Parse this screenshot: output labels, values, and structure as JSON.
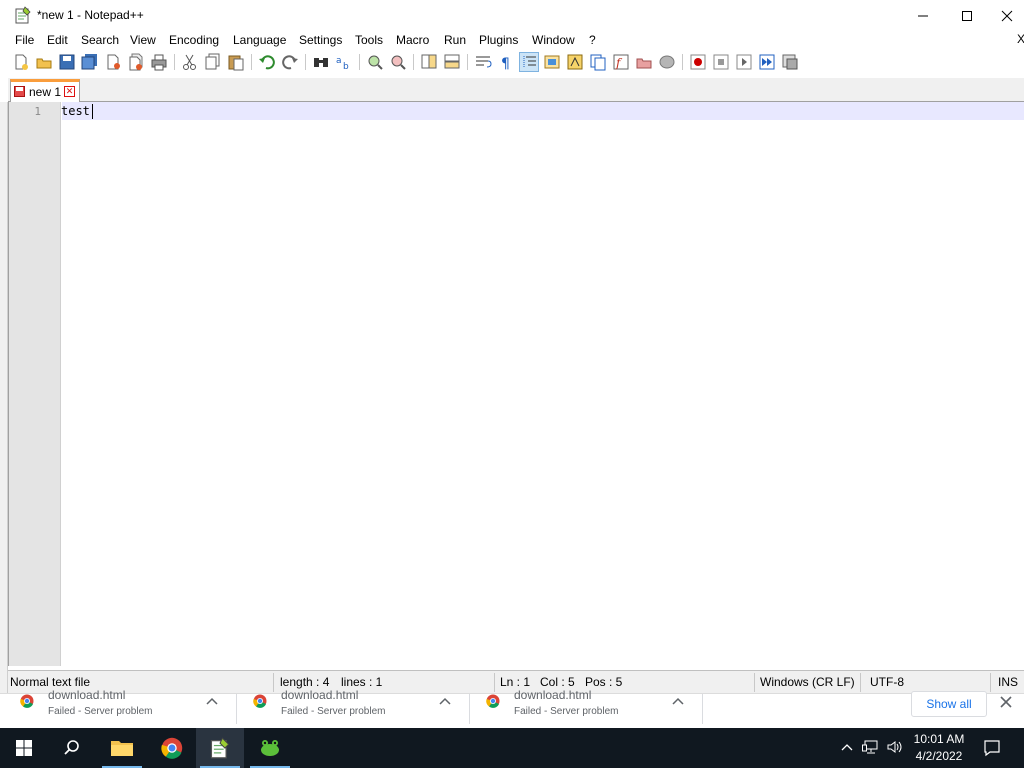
{
  "window": {
    "title": "*new 1 - Notepad++"
  },
  "menu": {
    "items": [
      "File",
      "Edit",
      "Search",
      "View",
      "Encoding",
      "Language",
      "Settings",
      "Tools",
      "Macro",
      "Run",
      "Plugins",
      "Window",
      "?"
    ],
    "overflow_close": "X"
  },
  "tabs": [
    {
      "label": "new 1",
      "close": "✕",
      "modified": true
    }
  ],
  "editor": {
    "lines": [
      {
        "number": "1",
        "text": "test"
      }
    ]
  },
  "statusbar": {
    "file_type": "Normal text file",
    "length": "length : 4",
    "lines": "lines : 1",
    "ln": "Ln : 1",
    "col": "Col : 5",
    "pos": "Pos : 5",
    "eol": "Windows (CR LF)",
    "encoding": "UTF-8",
    "mode": "INS"
  },
  "downloads": {
    "items": [
      {
        "name": "download.html",
        "status": "Failed - Server problem"
      },
      {
        "name": "download.html",
        "status": "Failed - Server problem"
      },
      {
        "name": "download.html",
        "status": "Failed - Server problem"
      }
    ],
    "show_all": "Show all"
  },
  "taskbar": {
    "time": "10:01 AM",
    "date": "4/2/2022",
    "apps": [
      "start",
      "search",
      "file-explorer",
      "chrome",
      "notepad-plus-plus",
      "app-frog"
    ]
  },
  "colors": {
    "tab_accent": "#fa9d3c",
    "line_highlight": "#e8e8ff",
    "taskbar_bg": "#101820",
    "link_blue": "#1a73e8"
  }
}
